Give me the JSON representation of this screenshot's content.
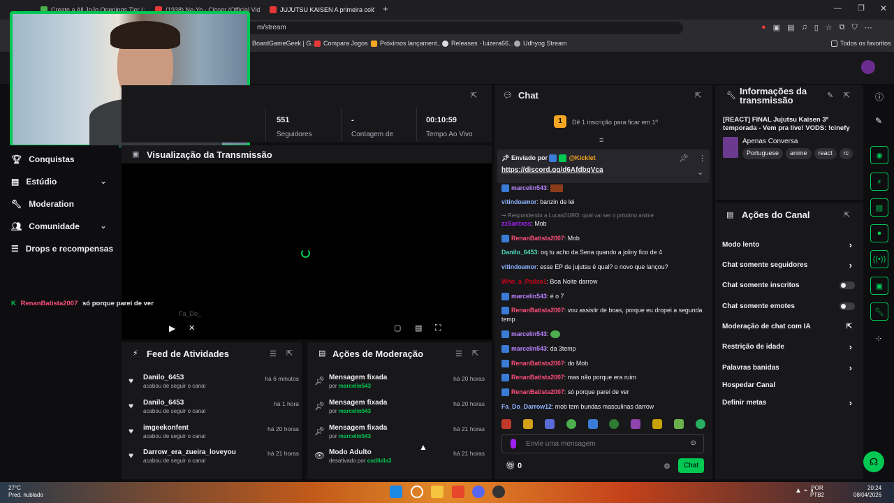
{
  "browser": {
    "tabs": [
      {
        "label": "Create a All JoJo Openings Tier List -",
        "color": "#4caf50"
      },
      {
        "label": "(1938) Ne-Yo - Closer (Official Video)",
        "color": "#e53935"
      },
      {
        "label": "JUJUTSU KAISEN A primeira colônia -",
        "color": "#e53935"
      }
    ],
    "new_tab": "+",
    "url": "m/stream",
    "bookmarks": [
      "BoardGameGeek | G...",
      "Compara Jogos",
      "Próximos lançament...",
      "Releases · luizera66...",
      "Udhyog Stream"
    ],
    "all_favorites": "Todos os favoritos"
  },
  "stats": {
    "followers_value": "551",
    "followers_label": "Seguidores",
    "count_value": "-",
    "count_label": "Contagem de",
    "live_value": "00:10:59",
    "live_label": "Tempo Ao Vivo"
  },
  "preview": {
    "title": "Visualização da Transmissão",
    "overlay_user": "Fa_Do_"
  },
  "sidebar": {
    "items": [
      {
        "label": "Conquistas",
        "icon": "trophy-icon"
      },
      {
        "label": "Estúdio",
        "icon": "studio-icon"
      },
      {
        "label": "Moderation",
        "icon": "wrench-icon"
      },
      {
        "label": "Comunidade",
        "icon": "community-icon"
      },
      {
        "label": "Drops e recompensas",
        "icon": "drops-icon"
      }
    ]
  },
  "overlay_chat": {
    "user": "RenanBatista2007",
    "message": "só porque parei de ver"
  },
  "feed": {
    "title": "Feed de Atividades",
    "rows": [
      {
        "user": "Danilo_6453",
        "action": "acabou de seguir o canal",
        "time": "há 6 minutos"
      },
      {
        "user": "Danilo_6453",
        "action": "acabou de seguir o canal",
        "time": "há 1 hora"
      },
      {
        "user": "imgeekonfent",
        "action": "acabou de seguir o canal",
        "time": "há 20 horas"
      },
      {
        "user": "Darrow_era_zueira_loveyou",
        "action": "acabou de seguir o canal",
        "time": "há 21 horas"
      }
    ]
  },
  "moderation": {
    "title": "Ações de Moderação",
    "rows": [
      {
        "title": "Mensagem fixada",
        "by": "por",
        "user": "marcelin543",
        "time": "há 20 horas"
      },
      {
        "title": "Mensagem fixada",
        "by": "por",
        "user": "marcelin543",
        "time": "há 20 horas"
      },
      {
        "title": "Mensagem fixada",
        "by": "por",
        "user": "marcelin543",
        "time": "há 21 horas"
      },
      {
        "title": "Modo Adulto",
        "by": "desativado por",
        "user": "cudibila3",
        "time": "há 21 horas"
      }
    ]
  },
  "chat": {
    "title": "Chat",
    "sub_count": "1",
    "sub_prompt": "Dê 1 inscrição para ficar em 1º",
    "pinned_by": "Enviado por",
    "pinned_user": "@Kicklet",
    "pinned_link": "https://discord.gg/d6AfdbqVca",
    "messages": [
      {
        "user": "marcelin543",
        "color": "#b983ff",
        "text": "",
        "badge": true
      },
      {
        "user": "vitindoamor",
        "color": "#8fb4ff",
        "text": "banzin de lei",
        "badge": false
      },
      {
        "reply": "Respondendo a Lucas01893: qual vai ser o próximo anime"
      },
      {
        "user": "zzSantxss",
        "color": "#a020f0",
        "text": "Mob",
        "badge": false
      },
      {
        "user": "RenanBatista2007",
        "color": "#ff4f7b",
        "text": "Mob",
        "badge": true
      },
      {
        "user": "Danilo_6453",
        "color": "#4cd7b5",
        "text": "oq tu acho da Sena quando a joliny fico de 4",
        "badge": false
      },
      {
        "user": "vitindoamor",
        "color": "#8fb4ff",
        "text": "esse EP de jujutsu é qual? o novo que lançou?",
        "badge": false
      },
      {
        "user": "Who_a_Pailxo1",
        "color": "#d0021b",
        "text": "Boa Noite darrow",
        "badge": false
      },
      {
        "user": "marcelin543",
        "color": "#b983ff",
        "text": "é o 7",
        "badge": true
      },
      {
        "user": "RenanBatista2007",
        "color": "#ff4f7b",
        "text": "vou assistir de boas, porque eu dropei a segunda temp",
        "badge": true
      },
      {
        "user": "marcelin543",
        "color": "#b983ff",
        "text": "",
        "badge": true
      },
      {
        "user": "marcelin543",
        "color": "#b983ff",
        "text": "da 3temp",
        "badge": true
      },
      {
        "user": "RenanBatista2007",
        "color": "#ff4f7b",
        "text": "do Mob",
        "badge": true
      },
      {
        "user": "RenanBatista2007",
        "color": "#ff4f7b",
        "text": "mas não porque era ruim",
        "badge": true
      },
      {
        "user": "RenanBatista2007",
        "color": "#ff4f7b",
        "text": "só porque parei de ver",
        "badge": true
      },
      {
        "user": "Fa_Do_Darrow12",
        "color": "#8fb4ff",
        "text": "mob tem bundas masculinas darrow",
        "badge": false
      }
    ],
    "input_placeholder": "Envie uma mensagem",
    "points": "0",
    "send_label": "Chat"
  },
  "stream_info": {
    "title": "Informações da transmissão",
    "stream_title": "[REACT] FINAL Jujutsu Kaisen 3ª temporada - Vem pra live! VODS: !cinefy",
    "category": "Apenas Conversa",
    "tags": [
      "Portuguese",
      "anime",
      "react",
      "rc"
    ]
  },
  "channel_actions": {
    "title": "Ações do Canal",
    "items": [
      {
        "label": "Modo lento",
        "control": "chevron"
      },
      {
        "label": "Chat somente seguidores",
        "control": "chevron"
      },
      {
        "label": "Chat somente inscritos",
        "control": "toggle"
      },
      {
        "label": "Chat somente emotes",
        "control": "toggle"
      },
      {
        "label": "Moderação de chat com IA",
        "control": "external"
      },
      {
        "label": "Restrição de idade",
        "control": "chevron"
      },
      {
        "label": "Palavras banidas",
        "control": "chevron"
      },
      {
        "label": "Hospedar Canal",
        "control": "none"
      },
      {
        "label": "Definir metas",
        "control": "chevron"
      }
    ]
  },
  "taskbar": {
    "weather_temp": "27°C",
    "weather_desc": "Pred. nublado",
    "lang": "POR",
    "lang2": "PTB2",
    "time": "20:24",
    "date": "08/04/2026"
  },
  "colors": {
    "accent": "#00c853",
    "panel": "#18181b",
    "bg": "#0e0e10"
  }
}
